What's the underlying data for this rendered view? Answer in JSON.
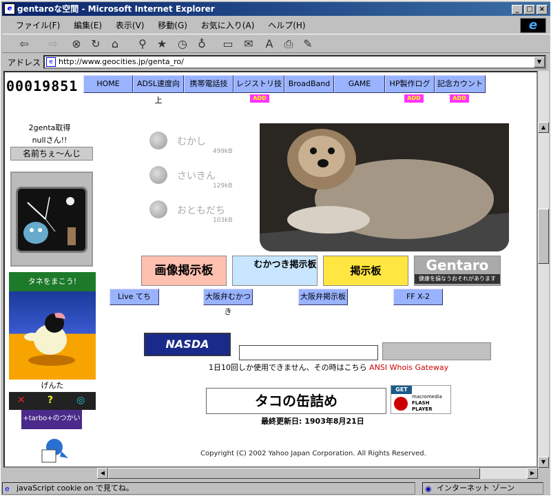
{
  "window": {
    "title": "gentaroな空間 - Microsoft Internet Explorer"
  },
  "menu": [
    "ファイル(F)",
    "編集(E)",
    "表示(V)",
    "移動(G)",
    "お気に入り(A)",
    "ヘルプ(H)"
  ],
  "address": {
    "label": "アドレス",
    "url": "http://www.geocities.jp/genta_ro/"
  },
  "counter": "00019851",
  "nav": [
    {
      "label": "HOME"
    },
    {
      "label": "ADSL速度向上"
    },
    {
      "label": "携帯電話技"
    },
    {
      "label": "レジストリ技",
      "badge": "ADD"
    },
    {
      "label": "BroadBand"
    },
    {
      "label": "GAME"
    },
    {
      "label": "HP製作ログ",
      "badge": "ADD"
    },
    {
      "label": "記念カウント",
      "badge": "ADD"
    }
  ],
  "sidebar": {
    "line1": "2genta取得",
    "line2": "nullさん!!",
    "rename_button": "名前ちぇ〜んじ",
    "tane_header": "タネをまこう!",
    "pet_name": "げんた",
    "tarbo_label": "+tarbo+のつかいかた"
  },
  "menu_items": [
    {
      "label": "むかし",
      "size": "499kB"
    },
    {
      "label": "さいきん",
      "size": "129kB"
    },
    {
      "label": "おともだち",
      "size": "103kB"
    }
  ],
  "bbs_banners": [
    {
      "label": "画像掲示板"
    },
    {
      "label": "むかつき掲示板"
    },
    {
      "label": "掲示板"
    },
    {
      "label": "Gentaro",
      "sub": "健康を損なうおそれがあります"
    }
  ],
  "link_buttons": [
    "Live てち",
    "大阪弁むかつき",
    "大阪弁掲示板",
    "FF X-2"
  ],
  "whois": {
    "banner": "NASDA",
    "note": "1日10回しか使用できません、その時はこちら",
    "link": "ANSI Whois Gateway"
  },
  "bottom_banners": {
    "manga": "タコの缶詰め",
    "flash_get": "GET",
    "flash_line1": "macromedia",
    "flash_line2": "FLASH",
    "flash_line3": "PLAYER"
  },
  "updated": "最終更新日: 1903年8月21日",
  "copyright": "Copyright (C) 2002 Yahoo Japan Corporation. All Rights Reserved.",
  "status": {
    "text": "javaScript cookie on で見てね。",
    "zone": "インターネット ゾーン"
  }
}
